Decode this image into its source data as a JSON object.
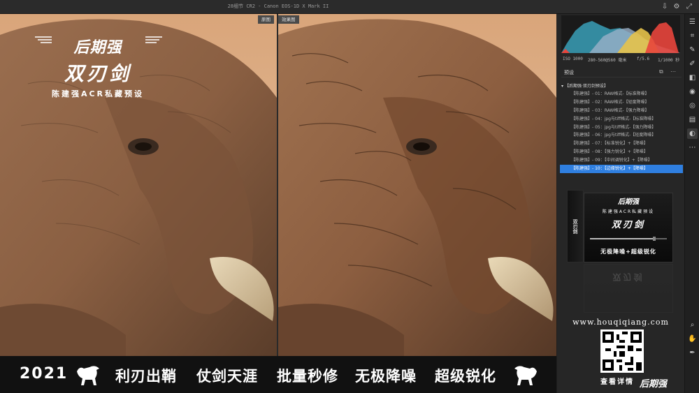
{
  "titlebar": {
    "title": "28细节 CR2 - Canon EOS-1D X Mark II",
    "icons": [
      "export-icon",
      "gear-icon",
      "expand-icon"
    ]
  },
  "canvas": {
    "before_label": "原图",
    "after_label": "效果图"
  },
  "brand": {
    "logo": "后期强",
    "name": "双刃剑",
    "subtitle": "陈建强ACR私藏预设"
  },
  "histogram": {
    "iso": "ISO 1000",
    "lens": "280-560@560 毫米",
    "aperture": "f/5.6",
    "shutter": "1/1000 秒"
  },
  "presets_panel": {
    "title": "预设",
    "group": "【后期强·双刃剑预设】",
    "items": [
      "【陈建强】- 01：RAW格式-【标准降噪】",
      "【陈建强】- 02：RAW格式-【轻度降噪】",
      "【陈建强】- 03：RAW格式-【强力降噪】",
      "【陈建强】- 04：jpg与tiff格式-【标准降噪】",
      "【陈建强】- 05：jpg与tiff格式-【强力降噪】",
      "【陈建强】- 06：jpg与tiff格式-【轻度降噪】",
      "【陈建强】- 07：【标准锐化】+【降噪】",
      "【陈建强】- 08：【强力锐化】+【降噪】",
      "【陈建强】- 09：【中间调锐化】+【降噪】",
      "【陈建强】- 10：【边缘锐化】+【降噪】"
    ],
    "selected_index": 9
  },
  "product": {
    "logo": "后期强",
    "subtitle": "陈建强ACR私藏预设",
    "name": "双刃剑",
    "tagline": "无极降噪+超级锐化",
    "side_text": "双刃剑"
  },
  "website": "www.houqiqiang.com",
  "qr_caption": "查看详情",
  "corner_logo": "后期强",
  "banner": {
    "year": "2021",
    "slogans": [
      "利刃出鞘",
      "仗剑天涯",
      "批量秒修",
      "无极降噪",
      "超级锐化"
    ]
  },
  "colors": {
    "accent": "#2f7fe0",
    "panel_bg": "#262626",
    "banner_bg": "#111111"
  }
}
